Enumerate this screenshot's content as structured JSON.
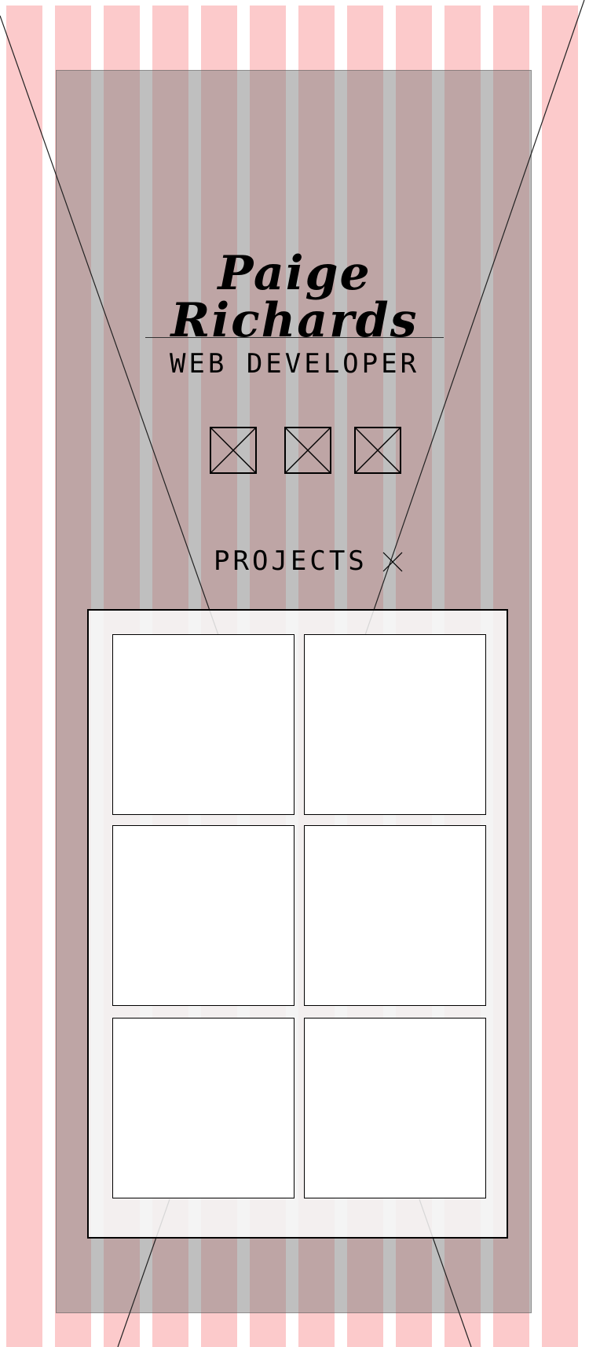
{
  "header": {
    "name": "Paige Richards",
    "title": "WEB DEVELOPER"
  },
  "social": {
    "icons": [
      "placeholder-icon",
      "placeholder-icon",
      "placeholder-icon"
    ]
  },
  "projects": {
    "heading": "PROJECTS",
    "heading_icon": "close-icon",
    "tile_count": 6
  },
  "colors": {
    "stripe": "#fccacb",
    "container": "#808080",
    "panel": "#ffffff",
    "text": "#000000"
  }
}
